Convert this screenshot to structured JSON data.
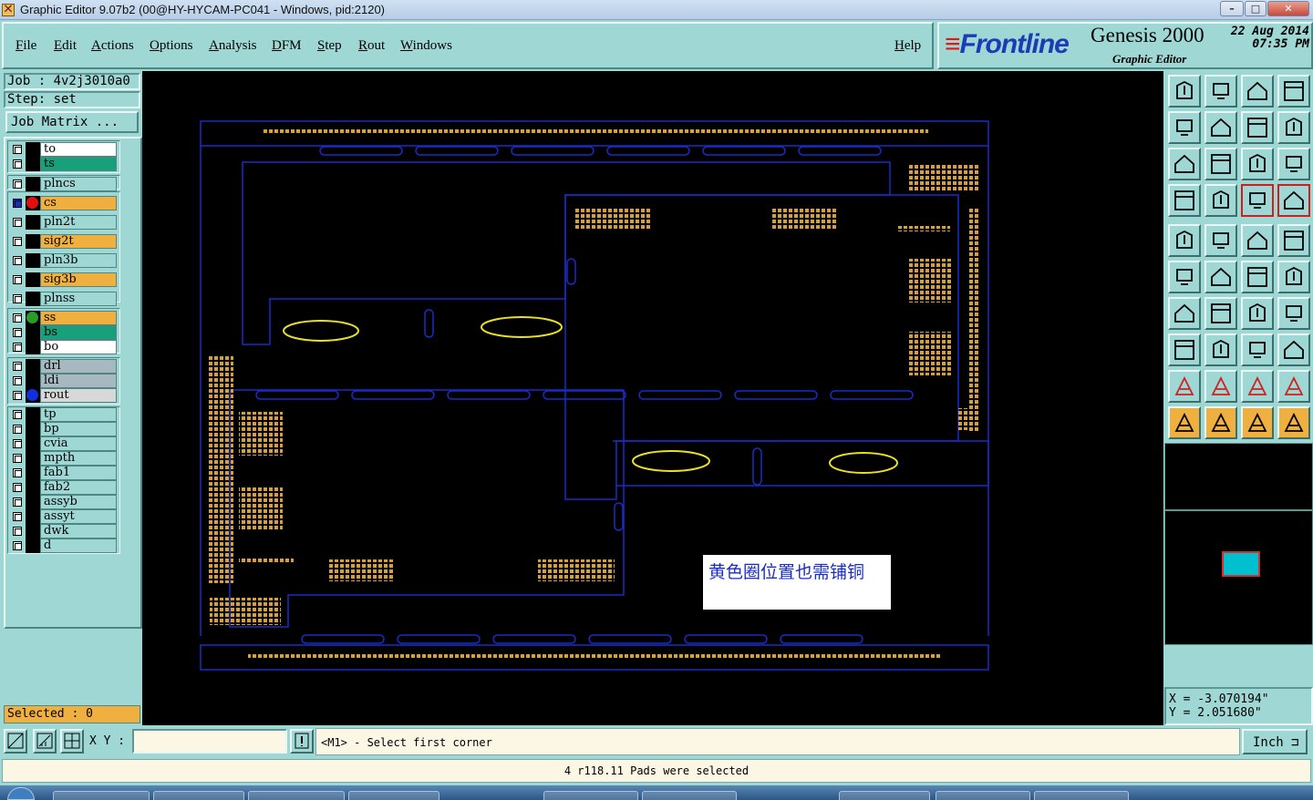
{
  "window": {
    "title": "Graphic Editor 9.07b2 (00@HY-HYCAM-PC041 - Windows, pid:2120)",
    "controls": [
      "–",
      "□",
      "✕"
    ]
  },
  "menu": {
    "items": [
      "File",
      "Edit",
      "Actions",
      "Options",
      "Analysis",
      "DFM",
      "Step",
      "Rout",
      "Windows"
    ],
    "help": "Help"
  },
  "branding": {
    "logo": "Frontline",
    "product": "Genesis 2000",
    "subtitle": "Graphic Editor",
    "date": "22 Aug 2014",
    "time": "07:35 PM"
  },
  "job": {
    "job_label": "Job : 4v2j3010a0",
    "step_label": "Step: set",
    "matrix_button": "Job Matrix ..."
  },
  "layers": [
    {
      "name": "to",
      "color": "#ffffff",
      "dot": ""
    },
    {
      "name": "ts",
      "color": "#18a07a",
      "dot": ""
    },
    {
      "name": "plncs",
      "color": "#9fd7d5",
      "dot": ""
    },
    {
      "name": "cs",
      "color": "#f0b040",
      "dot": "#e01010",
      "active": true
    },
    {
      "name": "pln2t",
      "color": "#9fd7d5",
      "dot": ""
    },
    {
      "name": "sig2t",
      "color": "#f0b040",
      "dot": ""
    },
    {
      "name": "pln3b",
      "color": "#9fd7d5",
      "dot": ""
    },
    {
      "name": "sig3b",
      "color": "#f0b040",
      "dot": ""
    },
    {
      "name": "plnss",
      "color": "#9fd7d5",
      "dot": ""
    },
    {
      "name": "ss",
      "color": "#f0b040",
      "dot": "#2a9a2a"
    },
    {
      "name": "bs",
      "color": "#18a07a",
      "dot": ""
    },
    {
      "name": "bo",
      "color": "#ffffff",
      "dot": ""
    },
    {
      "name": "drl",
      "color": "#a8b8c0",
      "dot": ""
    },
    {
      "name": "ldi",
      "color": "#a8b8c0",
      "dot": ""
    },
    {
      "name": "rout",
      "color": "#d8d8d8",
      "dot": "#1030e0"
    },
    {
      "name": "tp",
      "color": "#9fd7d5",
      "dot": ""
    },
    {
      "name": "bp",
      "color": "#9fd7d5",
      "dot": ""
    },
    {
      "name": "cvia",
      "color": "#9fd7d5",
      "dot": ""
    },
    {
      "name": "mpth",
      "color": "#9fd7d5",
      "dot": ""
    },
    {
      "name": "fab1",
      "color": "#9fd7d5",
      "dot": ""
    },
    {
      "name": "fab2",
      "color": "#9fd7d5",
      "dot": ""
    },
    {
      "name": "assyb",
      "color": "#9fd7d5",
      "dot": ""
    },
    {
      "name": "assyt",
      "color": "#9fd7d5",
      "dot": ""
    },
    {
      "name": "dwk",
      "color": "#9fd7d5",
      "dot": ""
    },
    {
      "name": "d",
      "color": "#9fd7d5",
      "dot": ""
    }
  ],
  "selected_label": "Selected : 0",
  "canvas": {
    "annotation": "黄色圈位置也需铺铜"
  },
  "coords": {
    "x": "X = -3.070194\"",
    "y": "Y = 2.051680\""
  },
  "bottom": {
    "xy_label": "X Y :",
    "xy_value": "",
    "prompt": "<M1> - Select first corner",
    "unit": "Inch"
  },
  "status": "4 r118.11 Pads were selected",
  "colors": {
    "panel": "#9fd7d5",
    "profile": "#1a2cc8",
    "pad": "#d9a030",
    "highlight": "#e8e020"
  }
}
